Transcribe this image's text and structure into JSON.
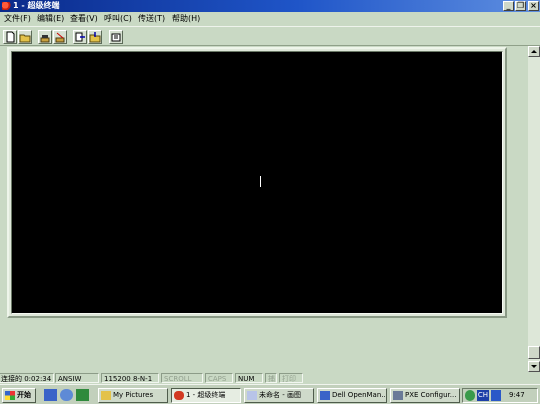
{
  "window": {
    "title": "1 - 超级终端",
    "minimize_glyph": "_",
    "restore_glyph": "❐",
    "close_glyph": "×"
  },
  "menu": {
    "file": "文件(F)",
    "edit": "编辑(E)",
    "view": "查看(V)",
    "call": "呼叫(C)",
    "transfer": "传送(T)",
    "help": "帮助(H)"
  },
  "toolbar": {
    "icons": [
      "new-file-icon",
      "open-folder-icon",
      "phone-icon",
      "disconnect-icon",
      "send-icon",
      "receive-icon",
      "properties-icon"
    ]
  },
  "terminal": {
    "background": "#000000",
    "cursor_char": "I"
  },
  "statusbar": {
    "connection": "连接的 0:02:34",
    "emulation": "ANSIW",
    "settings": "115200 8-N-1",
    "scroll": "SCROLL",
    "caps": "CAPS",
    "num": "NUM",
    "capture": "捕",
    "print": "打印"
  },
  "taskbar": {
    "start": "开始",
    "items": [
      "My Pictures",
      "1 - 超级终端",
      "未命名 - 画图",
      "Dell OpenMan...",
      "PXE Configur..."
    ],
    "tray_lang": "CH",
    "clock": "9:47"
  },
  "colors": {
    "title_start": "#0a2a8a",
    "title_end": "#5f8fe0",
    "chrome": "#c9d9c4"
  }
}
